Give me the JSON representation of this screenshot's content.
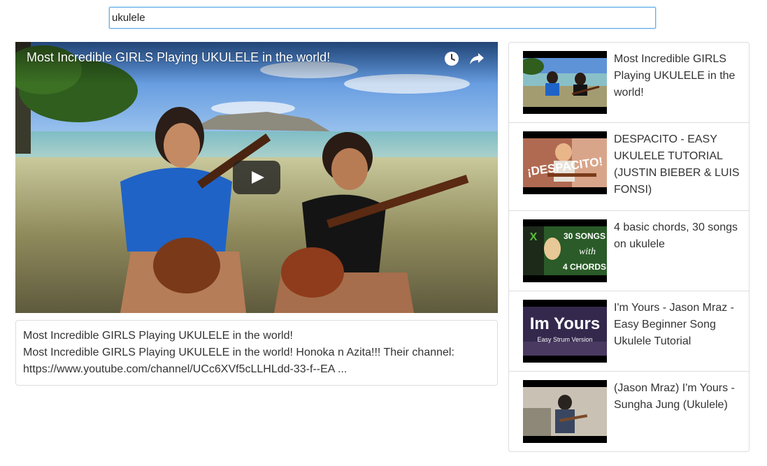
{
  "search": {
    "value": "ukulele",
    "placeholder": ""
  },
  "player": {
    "title": "Most Incredible GIRLS Playing UKULELE in the world!",
    "icons": {
      "watch_later": "clock-icon",
      "share": "share-arrow-icon",
      "play": "play-icon"
    }
  },
  "description": {
    "title": "Most Incredible GIRLS Playing UKULELE in the world!",
    "text": "Most Incredible GIRLS Playing UKULELE in the world! Honoka n Azita!!! Their channel: https://www.youtube.com/channel/UCc6XVf5cLLHLdd-33-f--EA ..."
  },
  "results": [
    {
      "title": "Most Incredible GIRLS Playing UKULELE in the world!"
    },
    {
      "title": "DESPACITO - EASY UKULELE TUTORIAL (JUSTIN BIEBER & LUIS FONSI)",
      "thumb_text": "¡DESPACITO!"
    },
    {
      "title": "4 basic chords, 30 songs on ukulele",
      "thumb_text_1": "30 SONGS",
      "thumb_text_2": "with",
      "thumb_text_3": "4 CHORDS"
    },
    {
      "title": "I'm Yours - Jason Mraz - Easy Beginner Song Ukulele Tutorial",
      "thumb_text": "Im Yours",
      "thumb_subtext": "Easy Strum Version"
    },
    {
      "title": "(Jason Mraz) I'm Yours - Sungha Jung (Ukulele)"
    }
  ],
  "colors": {
    "focus_border": "#66afe9",
    "panel_border": "#dddddd",
    "text": "#333333"
  }
}
